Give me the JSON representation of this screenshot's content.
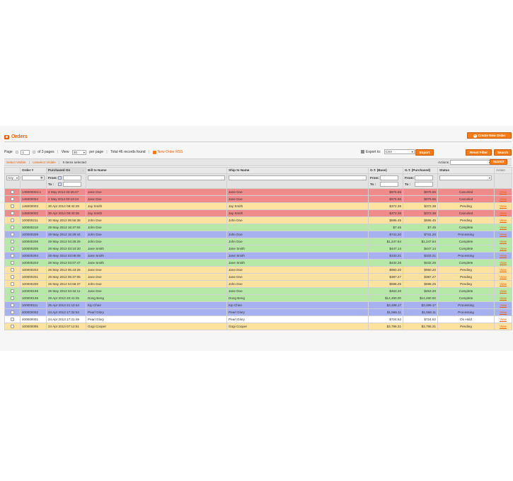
{
  "header": {
    "title": "Orders",
    "create_button": "Create New Order"
  },
  "pager": {
    "page_label": "Page",
    "page_value": "1",
    "of_pages": "of 3 pages",
    "view_label": "View",
    "per_page_value": "20",
    "per_page_label": "per page",
    "total": "Total 46 records found",
    "rss_link": "New Order RSS",
    "export_label": "Export to:",
    "export_format": "CSV",
    "export_button": "Export",
    "reset_button": "Reset Filter",
    "search_button": "Search"
  },
  "massaction": {
    "select_visible": "Select Visible",
    "unselect_visible": "Unselect Visible",
    "items_selected": "0 items selected",
    "actions_label": "Actions",
    "submit_button": "Submit"
  },
  "columns": [
    "Order #",
    "Purchased On",
    "Bill to Name",
    "Ship to Name",
    "G.T. (Base)",
    "G.T. (Purchased)",
    "Status",
    "Action"
  ],
  "filters": {
    "any_value": "Any",
    "from_label": "From:",
    "to_label": "To :"
  },
  "view_link": "View",
  "colors": {
    "accent": "#eb5e00",
    "canceled": "#f08b8b",
    "pending": "#fde2a0",
    "complete": "#b6e8a8",
    "processing": "#a8b1f0",
    "on_hold": "#ffffff"
  },
  "orders": [
    {
      "order": "145000004-1",
      "purchased": "4 May 2014 00:36:47",
      "bill": "Jane Doe",
      "ship": "Jane Doe",
      "base": "$975.55",
      "purchased_total": "$975.55",
      "status": "Canceled"
    },
    {
      "order": "145000004",
      "purchased": "4 May 2014 00:19:24",
      "bill": "Jane Doe",
      "ship": "Jane Doe",
      "base": "$975.55",
      "purchased_total": "$975.55",
      "status": "Canceled"
    },
    {
      "order": "145000003",
      "purchased": "30 Apr 2014 08:42:28",
      "bill": "Jay Smith",
      "ship": "Jay Smith",
      "base": "$372.38",
      "purchased_total": "$372.38",
      "status": "Pending"
    },
    {
      "order": "145000002",
      "purchased": "30 Apr 2014 08:40:36",
      "bill": "Jay Smith",
      "ship": "Jay Smith",
      "base": "$372.38",
      "purchased_total": "$372.38",
      "status": "Canceled"
    },
    {
      "order": "100000211",
      "purchased": "30 May 2013 05:55:38",
      "bill": "John Doe",
      "ship": "John Doe",
      "base": "$595.45",
      "purchased_total": "$595.45",
      "status": "Pending"
    },
    {
      "order": "100000210",
      "purchased": "29 May 2013 16:47:04",
      "bill": "John Doe",
      "ship": "",
      "base": "$7.45",
      "purchased_total": "$7.45",
      "status": "Complete"
    },
    {
      "order": "100000209",
      "purchased": "29 May 2013 16:29:44",
      "bill": "John Doe",
      "ship": "John Doe",
      "base": "$741.20",
      "purchased_total": "$741.20",
      "status": "Processing"
    },
    {
      "order": "100000206",
      "purchased": "29 May 2013 04:28:25",
      "bill": "John Doe",
      "ship": "John Doe",
      "base": "$1,247.64",
      "purchased_total": "$1,247.64",
      "status": "Complete"
    },
    {
      "order": "100000205",
      "purchased": "28 May 2013 03:10:20",
      "bill": "Jane Smith",
      "ship": "Jane Smith",
      "base": "$447.14",
      "purchased_total": "$447.14",
      "status": "Complete"
    },
    {
      "order": "100000204",
      "purchased": "28 May 2013 03:08:08",
      "bill": "Jane Smith",
      "ship": "Jane Smith",
      "base": "$333.21",
      "purchased_total": "$333.21",
      "status": "Processing"
    },
    {
      "order": "100000203",
      "purchased": "28 May 2013 03:07:47",
      "bill": "Jane Smith",
      "ship": "Jane Smith",
      "base": "$432.26",
      "purchased_total": "$432.26",
      "status": "Complete"
    },
    {
      "order": "100000202",
      "purchased": "26 May 2013 05:43:25",
      "bill": "Jane Doe",
      "ship": "Jane Doe",
      "base": "$950.20",
      "purchased_total": "$950.20",
      "status": "Pending"
    },
    {
      "order": "100000201",
      "purchased": "26 May 2013 05:37:05",
      "bill": "Jane Doe",
      "ship": "Jane Doe",
      "base": "$387.27",
      "purchased_total": "$387.27",
      "status": "Pending"
    },
    {
      "order": "100000200",
      "purchased": "25 May 2013 04:58:37",
      "bill": "John Doe",
      "ship": "John Doe",
      "base": "$598.25",
      "purchased_total": "$598.25",
      "status": "Pending"
    },
    {
      "order": "100000199",
      "purchased": "25 May 2013 04:42:11",
      "bill": "Jane Doe",
      "ship": "Jane Doe",
      "base": "$453.20",
      "purchased_total": "$453.20",
      "status": "Complete"
    },
    {
      "order": "100000135",
      "purchased": "29 Apr 2013 20:41:25",
      "bill": "Dong Beng",
      "ship": "Dong Beng",
      "base": "$14,490.00",
      "purchased_total": "$14,490.00",
      "status": "Complete"
    },
    {
      "order": "100000111",
      "purchased": "25 Apr 2013 21:10:44",
      "bill": "Kip Chee",
      "ship": "Kip Chee",
      "base": "$3,499.17",
      "purchased_total": "$3,499.17",
      "status": "Processing"
    },
    {
      "order": "400000002",
      "purchased": "24 Apr 2013 17:32:54",
      "bill": "Pearl Glory",
      "ship": "Pearl Glory",
      "base": "$1,566.11",
      "purchased_total": "$1,566.11",
      "status": "Processing"
    },
    {
      "order": "400000001",
      "purchased": "24 Apr 2013 17:21:49",
      "bill": "Pearl Glory",
      "ship": "Pearl Glory",
      "base": "$724.62",
      "purchased_total": "$724.62",
      "status": "On Hold"
    },
    {
      "order": "100000095",
      "purchased": "24 Apr 2013 07:12:51",
      "bill": "Gogi Cooper",
      "ship": "Gogi Cooper",
      "base": "$3,796.31",
      "purchased_total": "$3,796.31",
      "status": "Pending"
    }
  ]
}
